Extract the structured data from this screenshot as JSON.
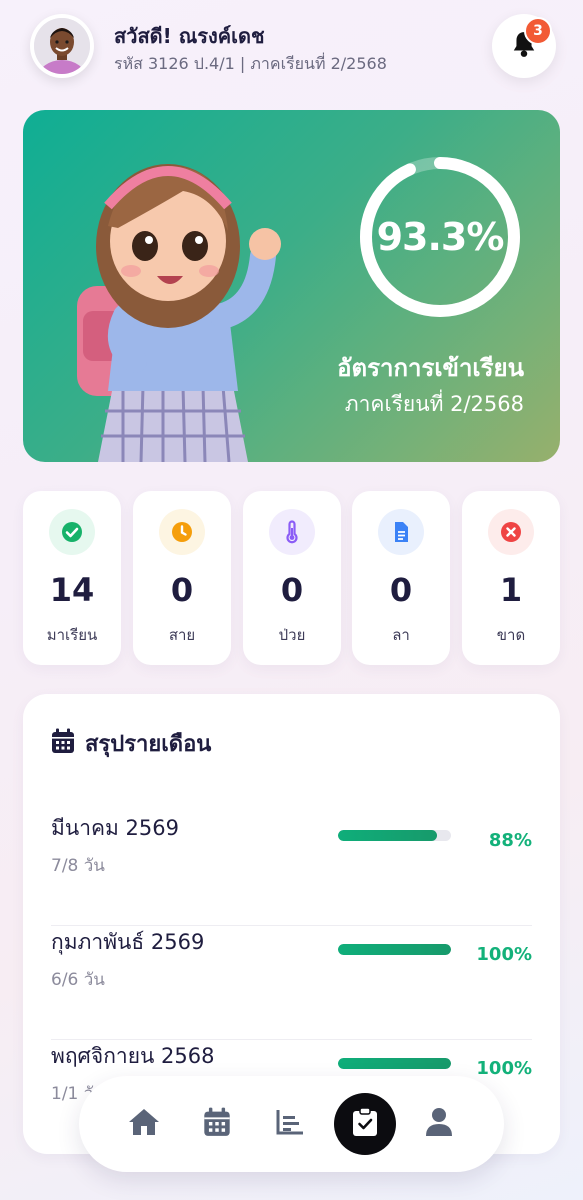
{
  "header": {
    "greeting": "สวัสดี! ณรงค์เดช",
    "subinfo": "รหัส 3126 ป.4/1 | ภาคเรียนที่ 2/2568",
    "notification_count": "3"
  },
  "hero": {
    "attendance_percent_text": "93.3%",
    "attendance_fraction": 0.933,
    "title": "อัตราการเข้าเรียน",
    "subtitle": "ภาคเรียนที่ 2/2568"
  },
  "stats": [
    {
      "value": "14",
      "label": "มาเรียน",
      "icon": "check-circle-icon",
      "color": "#17b26a",
      "bg": "#e6f8ef"
    },
    {
      "value": "0",
      "label": "สาย",
      "icon": "clock-icon",
      "color": "#f59e0b",
      "bg": "#fdf5e2"
    },
    {
      "value": "0",
      "label": "ป่วย",
      "icon": "thermometer-icon",
      "color": "#8b5cf6",
      "bg": "#f1ecfd"
    },
    {
      "value": "0",
      "label": "ลา",
      "icon": "document-icon",
      "color": "#3b82f6",
      "bg": "#e9f0fd"
    },
    {
      "value": "1",
      "label": "ขาด",
      "icon": "x-circle-icon",
      "color": "#ef4444",
      "bg": "#fdeceb"
    }
  ],
  "summary": {
    "title": "สรุปรายเดือน",
    "rows": [
      {
        "month": "มีนาคม 2569",
        "days": "7/8 วัน",
        "percent": "88%",
        "fraction": 0.88
      },
      {
        "month": "กุมภาพันธ์ 2569",
        "days": "6/6 วัน",
        "percent": "100%",
        "fraction": 1.0
      },
      {
        "month": "พฤศจิกายน 2568",
        "days": "1/1 วัน",
        "percent": "100%",
        "fraction": 1.0
      }
    ]
  },
  "nav": {
    "items": [
      "home-icon",
      "calendar-icon",
      "chart-icon",
      "clipboard-check-icon",
      "profile-icon"
    ],
    "active": "clipboard-check-icon"
  },
  "colors": {
    "accent_green": "#13b17a",
    "badge": "#f25a35"
  }
}
